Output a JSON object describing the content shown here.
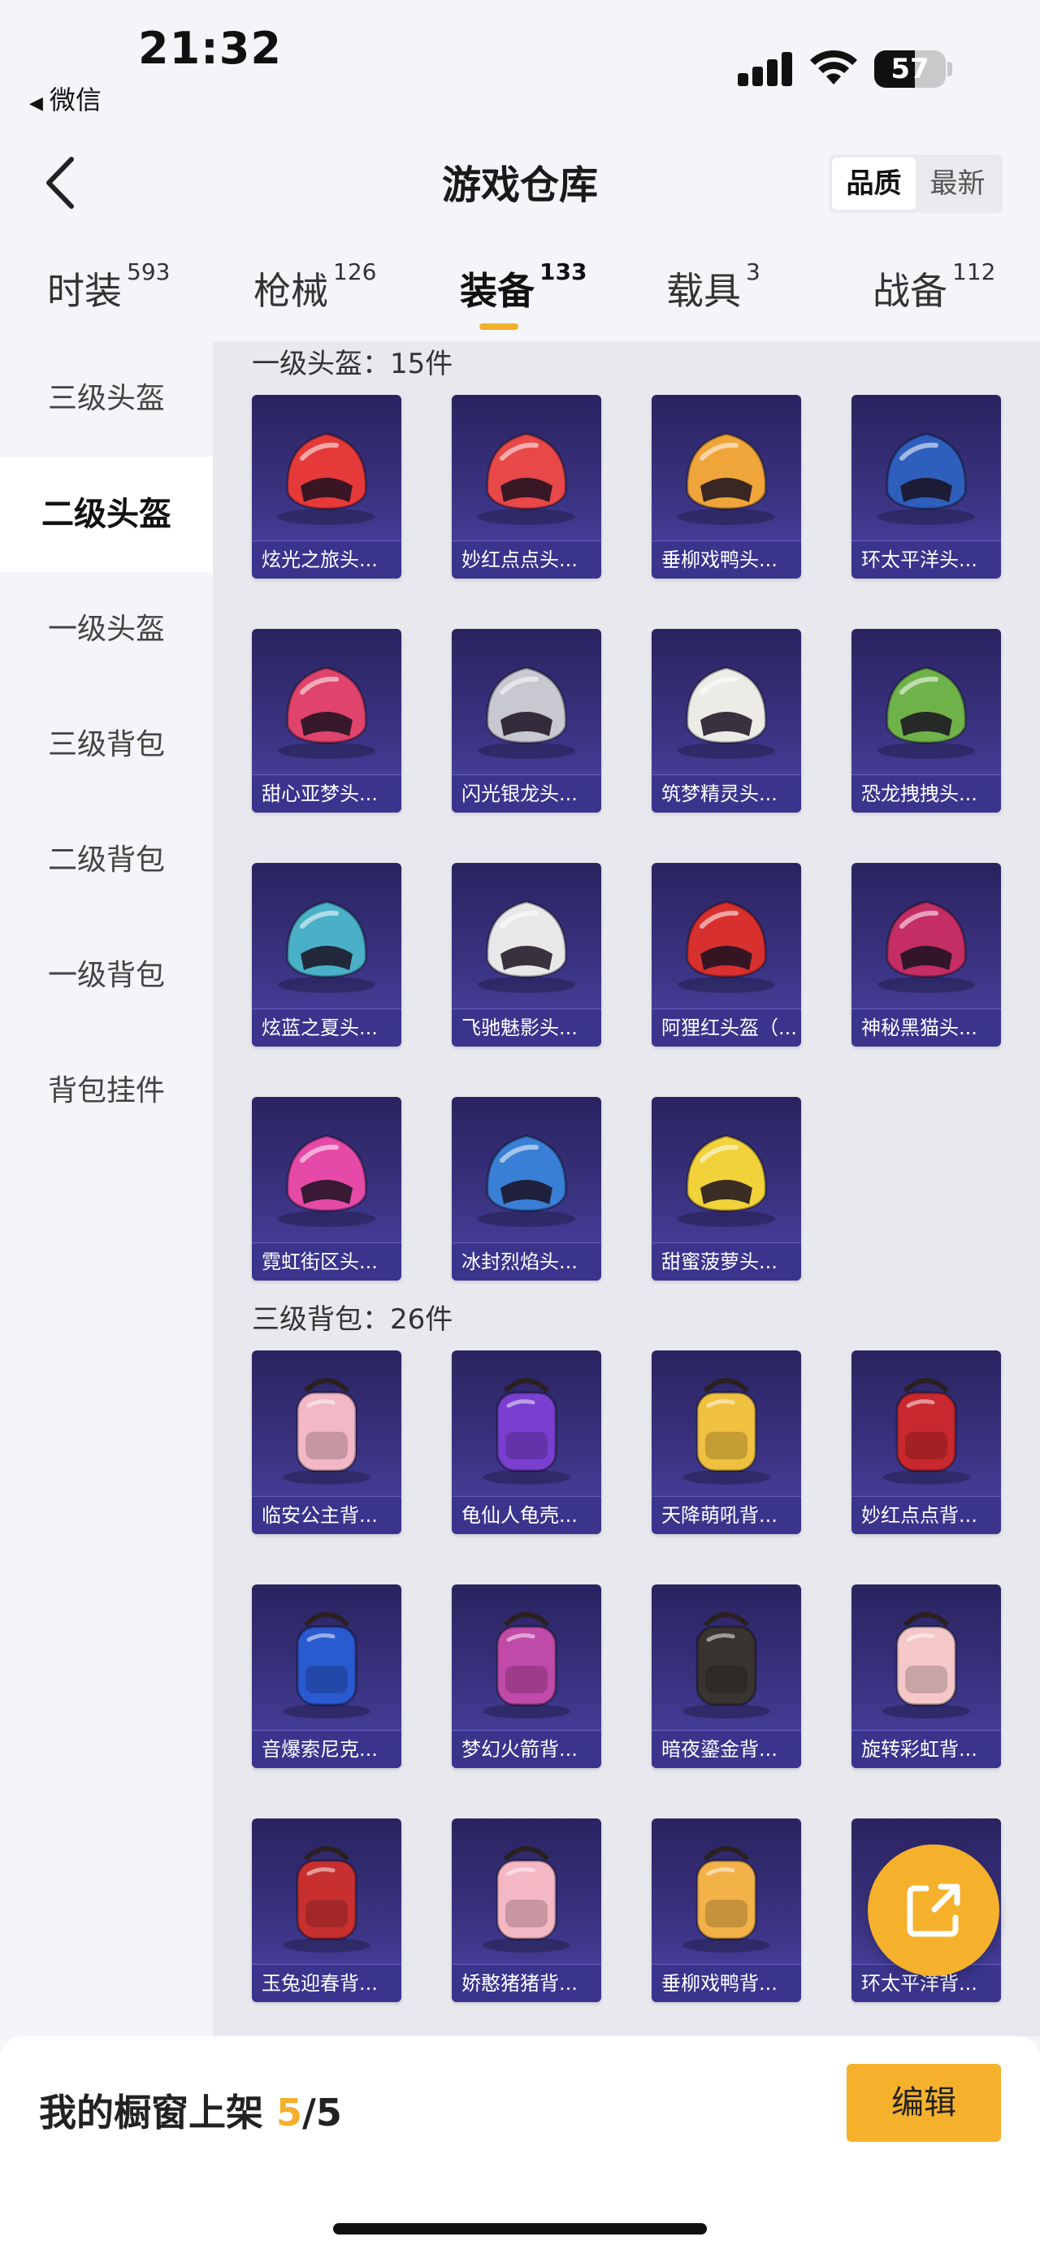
{
  "status_bar": {
    "time": "21:32",
    "back_app": "微信",
    "battery": "57",
    "battery_level": 0.57
  },
  "nav": {
    "title": "游戏仓库",
    "sort_options": [
      "品质",
      "最新"
    ],
    "active_sort": 0
  },
  "tabs": [
    {
      "label": "时装",
      "count": "593"
    },
    {
      "label": "枪械",
      "count": "126"
    },
    {
      "label": "装备",
      "count": "133"
    },
    {
      "label": "载具",
      "count": "3"
    },
    {
      "label": "战备",
      "count": "112"
    }
  ],
  "active_tab": 2,
  "sidebar": [
    {
      "label": "三级头盔"
    },
    {
      "label": "二级头盔"
    },
    {
      "label": "一级头盔"
    },
    {
      "label": "三级背包"
    },
    {
      "label": "二级背包"
    },
    {
      "label": "一级背包"
    },
    {
      "label": "背包挂件"
    }
  ],
  "active_sidebar": 1,
  "sections": [
    {
      "title": "一级头盔：15件",
      "items": [
        {
          "name": "炫光之旅头...",
          "icon": "helmet-icon",
          "color": "#e63a3a"
        },
        {
          "name": "妙红点点头...",
          "icon": "helmet-icon",
          "color": "#e84848"
        },
        {
          "name": "垂柳戏鸭头...",
          "icon": "helmet-icon",
          "color": "#f0a53a"
        },
        {
          "name": "环太平洋头...",
          "icon": "helmet-icon",
          "color": "#2f5fbd"
        },
        {
          "name": "甜心亚梦头...",
          "icon": "helmet-icon",
          "color": "#e0436b"
        },
        {
          "name": "闪光银龙头...",
          "icon": "helmet-icon",
          "color": "#c8c8d0"
        },
        {
          "name": "筑梦精灵头...",
          "icon": "helmet-icon",
          "color": "#ecebe6"
        },
        {
          "name": "恐龙拽拽头...",
          "icon": "helmet-icon",
          "color": "#6fb24a"
        },
        {
          "name": "炫蓝之夏头...",
          "icon": "helmet-icon",
          "color": "#4ab0c8"
        },
        {
          "name": "飞驰魅影头...",
          "icon": "helmet-icon",
          "color": "#e8e8e8"
        },
        {
          "name": "阿狸红头盔（...",
          "icon": "helmet-icon",
          "color": "#d8302e"
        },
        {
          "name": "神秘黑猫头...",
          "icon": "helmet-icon",
          "color": "#c42e64"
        },
        {
          "name": "霓虹街区头...",
          "icon": "helmet-icon",
          "color": "#e64aa8"
        },
        {
          "name": "冰封烈焰头...",
          "icon": "helmet-icon",
          "color": "#3a7fd6"
        },
        {
          "name": "甜蜜菠萝头...",
          "icon": "helmet-icon",
          "color": "#f2d23a"
        }
      ]
    },
    {
      "title": "三级背包：26件",
      "items": [
        {
          "name": "临安公主背...",
          "icon": "backpack-icon",
          "color": "#f2b8c6"
        },
        {
          "name": "龟仙人龟壳...",
          "icon": "backpack-icon",
          "color": "#7a3fd0"
        },
        {
          "name": "天降萌吼背...",
          "icon": "backpack-icon",
          "color": "#f0c040"
        },
        {
          "name": "妙红点点背...",
          "icon": "backpack-icon",
          "color": "#c8282e"
        },
        {
          "name": "音爆索尼克...",
          "icon": "backpack-icon",
          "color": "#2a5ad0"
        },
        {
          "name": "梦幻火箭背...",
          "icon": "backpack-icon",
          "color": "#c04aa8"
        },
        {
          "name": "暗夜鎏金背...",
          "icon": "backpack-icon",
          "color": "#3a3430"
        },
        {
          "name": "旋转彩虹背...",
          "icon": "backpack-icon",
          "color": "#f4c8c8"
        },
        {
          "name": "玉兔迎春背...",
          "icon": "backpack-icon",
          "color": "#c83030"
        },
        {
          "name": "娇憨猪猪背...",
          "icon": "backpack-icon",
          "color": "#f4b8c4"
        },
        {
          "name": "垂柳戏鸭背...",
          "icon": "backpack-icon",
          "color": "#f2b248"
        },
        {
          "name": "环太平洋背...",
          "icon": "backpack-icon",
          "color": "#2f5fbd"
        }
      ]
    }
  ],
  "bottom": {
    "showcase_label": "我的橱窗上架",
    "showcase_current": "5",
    "showcase_total": "/5",
    "edit_label": "编辑"
  },
  "colors": {
    "accent": "#f3b02c",
    "card_bg": "#3a3381"
  }
}
